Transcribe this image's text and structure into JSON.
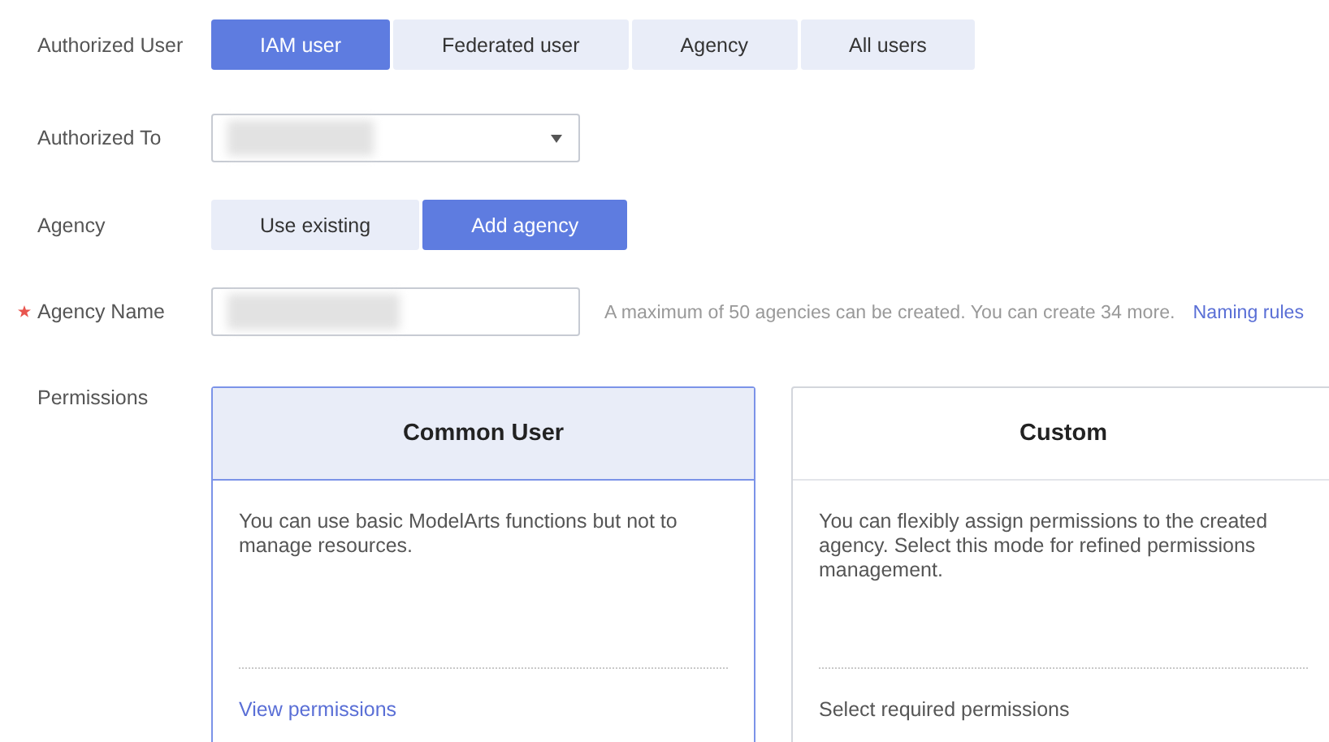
{
  "fields": [
    {
      "kind": "segmented",
      "label": "Authorized User",
      "required": false,
      "options": [
        {
          "label": "IAM user",
          "selected": true
        },
        {
          "label": "Federated user",
          "selected": false
        },
        {
          "label": "Agency",
          "selected": false
        },
        {
          "label": "All users",
          "selected": false
        }
      ]
    },
    {
      "kind": "select",
      "label": "Authorized To",
      "required": false
    },
    {
      "kind": "segmented",
      "label": "Agency",
      "required": false,
      "options": [
        {
          "label": "Use existing",
          "selected": false
        },
        {
          "label": "Add agency",
          "selected": true
        }
      ]
    },
    {
      "kind": "input",
      "label": "Agency Name",
      "required": true,
      "hint": "A maximum of 50 agencies can be created. You can create 34 more.",
      "link": "Naming rules"
    }
  ],
  "permissions": {
    "label": "Permissions",
    "cards": [
      {
        "title": "Common User",
        "selected": true,
        "description": "You can use basic ModelArts functions but not to manage resources.",
        "footer": {
          "kind": "link",
          "text": "View permissions"
        }
      },
      {
        "title": "Custom",
        "selected": false,
        "description": "You can flexibly assign permissions to the created agency. Select this mode for refined permissions management.",
        "footer": {
          "kind": "text",
          "text": "Select required permissions"
        }
      }
    ]
  }
}
